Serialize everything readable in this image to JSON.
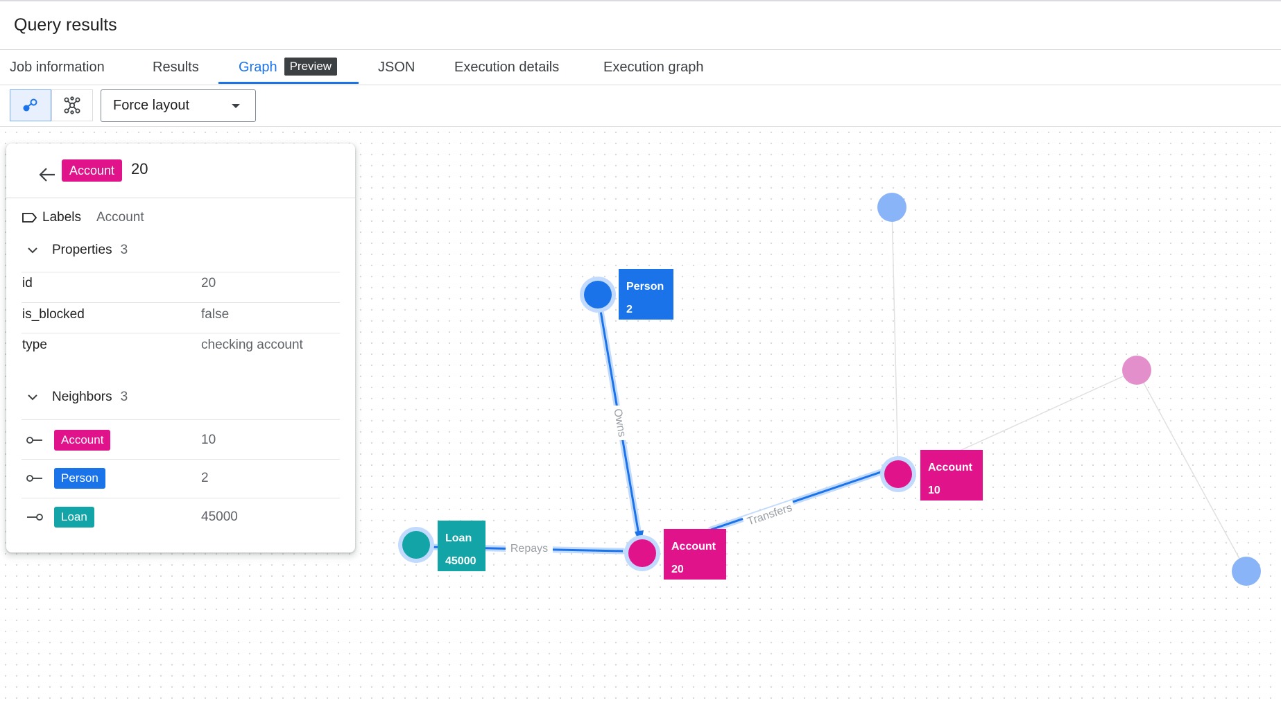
{
  "window": {
    "title": "Query results"
  },
  "tabs": [
    {
      "label": "Job information"
    },
    {
      "label": "Results"
    },
    {
      "label": "Graph",
      "badge": "Preview",
      "active": true
    },
    {
      "label": "JSON"
    },
    {
      "label": "Execution details"
    },
    {
      "label": "Execution graph"
    }
  ],
  "toolbar": {
    "layout_select": {
      "value": "Force layout"
    }
  },
  "details": {
    "label_chip": "Account",
    "id": "20",
    "labels": {
      "key": "Labels",
      "value": "Account"
    },
    "properties": {
      "title": "Properties",
      "count": "3",
      "rows": [
        {
          "key": "id",
          "value": "20"
        },
        {
          "key": "is_blocked",
          "value": "false"
        },
        {
          "key": "type",
          "value": "checking account"
        }
      ]
    },
    "neighbors": {
      "title": "Neighbors",
      "count": "3",
      "rows": [
        {
          "label": "Account",
          "value": "10",
          "direction": "outgoing"
        },
        {
          "label": "Person",
          "value": "2",
          "direction": "outgoing"
        },
        {
          "label": "Loan",
          "value": "45000",
          "direction": "incoming"
        }
      ]
    }
  },
  "graph": {
    "colors": {
      "account": "#e0138a",
      "person": "#1a73e8",
      "loan": "#12a4a6",
      "faded_person": "#8ab4f8",
      "faded_account": "#e38fcb",
      "highlight_edge": "#1a73e8",
      "highlight_halo": "#c2dafd"
    },
    "nodes": [
      {
        "label": "Person",
        "value": "2"
      },
      {
        "label": "Account",
        "value": "20"
      },
      {
        "label": "Account",
        "value": "10"
      },
      {
        "label": "Loan",
        "value": "45000"
      }
    ],
    "edges": [
      {
        "label": "Owns"
      },
      {
        "label": "Repays"
      },
      {
        "label": "Transfers"
      }
    ]
  }
}
